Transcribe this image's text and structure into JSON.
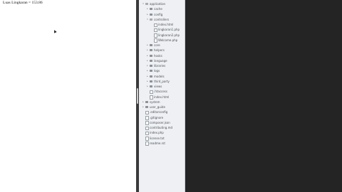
{
  "browser": {
    "page_text": "Luas Lingkaran = 153.86"
  },
  "file_tree": [
    {
      "label": "application",
      "kind": "folder",
      "open": true,
      "depth": 0
    },
    {
      "label": "cache",
      "kind": "folder",
      "open": false,
      "depth": 1
    },
    {
      "label": "config",
      "kind": "folder",
      "open": false,
      "depth": 1
    },
    {
      "label": "controllers",
      "kind": "folder",
      "open": true,
      "depth": 1
    },
    {
      "label": "index.html",
      "kind": "file",
      "depth": 2
    },
    {
      "label": "lingkaran1.php",
      "kind": "file",
      "depth": 2
    },
    {
      "label": "lingkaran2.php",
      "kind": "file",
      "depth": 2
    },
    {
      "label": "Welcome.php",
      "kind": "file",
      "depth": 2
    },
    {
      "label": "core",
      "kind": "folder",
      "open": false,
      "depth": 1
    },
    {
      "label": "helpers",
      "kind": "folder",
      "open": false,
      "depth": 1
    },
    {
      "label": "hooks",
      "kind": "folder",
      "open": false,
      "depth": 1
    },
    {
      "label": "language",
      "kind": "folder",
      "open": false,
      "depth": 1
    },
    {
      "label": "libraries",
      "kind": "folder",
      "open": false,
      "depth": 1
    },
    {
      "label": "logs",
      "kind": "folder",
      "open": false,
      "depth": 1
    },
    {
      "label": "models",
      "kind": "folder",
      "open": false,
      "depth": 1
    },
    {
      "label": "third_party",
      "kind": "folder",
      "open": false,
      "depth": 1
    },
    {
      "label": "views",
      "kind": "folder",
      "open": false,
      "depth": 1
    },
    {
      "label": ".htaccess",
      "kind": "file",
      "depth": 1
    },
    {
      "label": "index.html",
      "kind": "file",
      "depth": 1
    },
    {
      "label": "system",
      "kind": "folder",
      "open": false,
      "depth": 0
    },
    {
      "label": "user_guide",
      "kind": "folder",
      "open": false,
      "depth": 0
    },
    {
      "label": ".editorconfig",
      "kind": "file",
      "depth": 0
    },
    {
      "label": ".gitignore",
      "kind": "file",
      "depth": 0
    },
    {
      "label": "composer.json",
      "kind": "file",
      "depth": 0
    },
    {
      "label": "contributing.md",
      "kind": "file",
      "depth": 0
    },
    {
      "label": "index.php",
      "kind": "file",
      "depth": 0
    },
    {
      "label": "license.txt",
      "kind": "file",
      "depth": 0
    },
    {
      "label": "readme.rst",
      "kind": "file",
      "depth": 0
    }
  ],
  "colors": {
    "editor_bg": "#242424",
    "sidebar_bg": "#eef0f3",
    "divider": "#3a3a3a"
  }
}
